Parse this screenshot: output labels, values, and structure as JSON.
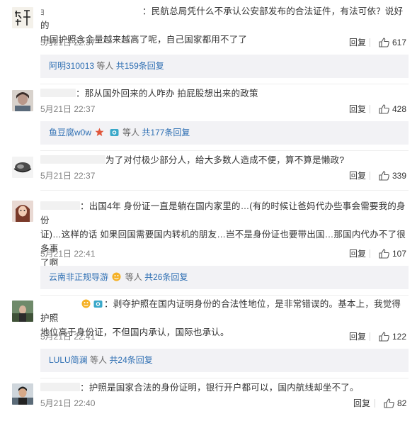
{
  "ui": {
    "reply_label": "回复",
    "like_icon": "thumbs-up-icon",
    "colors": {
      "link": "#2e6fb3",
      "meta": "#808080",
      "sub_bg": "#f2f2f5"
    }
  },
  "comments": [
    {
      "username_visible": "ﾖ",
      "text_line1": "：民航总局凭什么不承认公安部发布的合法证件，有法可依？说好的",
      "text_line2": "中国护照含金量越来越高了呢，自己国家都用不了了",
      "time": "5月21日 22:37",
      "likes": "617",
      "sub": {
        "user": "阿明310013",
        "mid": "等人",
        "count": "共159条回复"
      }
    },
    {
      "text_line1": "：那从国外回来的人咋办 拍屁股想出来的政策",
      "time": "5月21日 22:37",
      "likes": "428",
      "sub": {
        "user": "鱼豆腐w0w",
        "mid": "等人",
        "count": "共177条回复"
      }
    },
    {
      "text_line1": "为了对付极少部分人，给大多数人造成不便，算不算是懒政?",
      "time": "5月21日 22:37",
      "likes": "339"
    },
    {
      "text_line1": "：出国4年 身份证一直是躺在国内家里的…(有的时候让爸妈代办些事会需要我的身份",
      "text_line2": "证)…这样的话 如果回国需要国内转机的朋友…岂不是身份证也要带出国…那国内代办不了很多事",
      "text_line3": "了啊",
      "time": "5月21日 22:41",
      "likes": "107",
      "sub": {
        "user": "云南非正规导游",
        "mid": "等人",
        "count": "共26条回复"
      }
    },
    {
      "text_line1": "：剥夺护照在国内证明身份的合法性地位，是非常错误的。基本上，我觉得护照",
      "text_line2": "地位高于身份证，不但国内承认，国际也承认。",
      "time": "5月21日 22:41",
      "likes": "122",
      "sub": {
        "user": "LULU简澜",
        "mid": "等人",
        "count": "共24条回复"
      }
    },
    {
      "text_line1": "：护照是国家合法的身份证明，银行开户都可以，国内航线却坐不了。",
      "time": "5月21日 22:40",
      "likes": "82"
    }
  ]
}
